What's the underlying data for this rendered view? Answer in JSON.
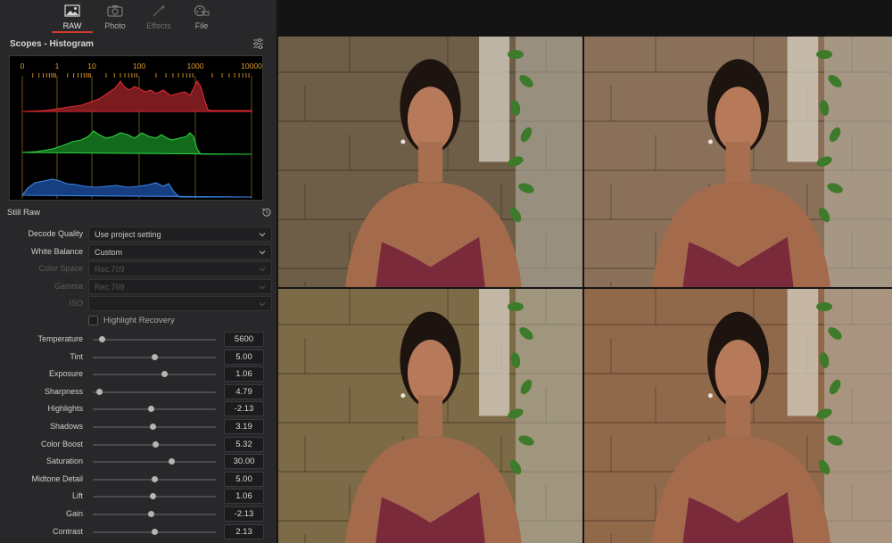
{
  "tabs": [
    {
      "label": "RAW",
      "icon": "image-icon",
      "state": "active"
    },
    {
      "label": "Photo",
      "icon": "camera-icon",
      "state": "normal"
    },
    {
      "label": "Effects",
      "icon": "magic-wand-icon",
      "state": "disabled"
    },
    {
      "label": "File",
      "icon": "film-reel-icon",
      "state": "normal"
    }
  ],
  "scopes": {
    "title": "Scopes - Histogram",
    "settings_icon": "sliders-icon",
    "scale_labels": [
      "0",
      "1",
      "10",
      "100",
      "1000",
      "10000"
    ],
    "channel_colors": {
      "red": "#d8242c",
      "green": "#22c03a",
      "blue": "#2a6fd6"
    }
  },
  "still_raw": {
    "title": "Still Raw",
    "reset_icon": "reset-icon",
    "dropdowns": [
      {
        "label": "Decode Quality",
        "value": "Use project setting",
        "enabled": true
      },
      {
        "label": "White Balance",
        "value": "Custom",
        "enabled": true
      },
      {
        "label": "Color Space",
        "value": "Rec.709",
        "enabled": false
      },
      {
        "label": "Gamma",
        "value": "Rec.709",
        "enabled": false
      },
      {
        "label": "ISO",
        "value": "",
        "enabled": false
      }
    ],
    "highlight_recovery": {
      "label": "Highlight Recovery",
      "checked": false
    },
    "sliders": [
      {
        "label": "Temperature",
        "value": "5600",
        "level": 0.05
      },
      {
        "label": "Tint",
        "value": "5.00",
        "level": 0.5
      },
      {
        "label": "Exposure",
        "value": "1.06",
        "level": 0.59
      },
      {
        "label": "Sharpness",
        "value": "4.79",
        "level": 0.03
      },
      {
        "label": "Highlights",
        "value": "-2.13",
        "level": 0.47
      },
      {
        "label": "Shadows",
        "value": "3.19",
        "level": 0.49
      },
      {
        "label": "Color Boost",
        "value": "5.32",
        "level": 0.51
      },
      {
        "label": "Saturation",
        "value": "30.00",
        "level": 0.65
      },
      {
        "label": "Midtone Detail",
        "value": "5.00",
        "level": 0.5
      },
      {
        "label": "Lift",
        "value": "1.06",
        "level": 0.49
      },
      {
        "label": "Gain",
        "value": "-2.13",
        "level": 0.47
      },
      {
        "label": "Contrast",
        "value": "2.13",
        "level": 0.5
      }
    ]
  },
  "viewer": {
    "frames": [
      {
        "tint": "#6e5e48"
      },
      {
        "tint": "#8a7058"
      },
      {
        "tint": "#7d6a46"
      },
      {
        "tint": "#90684a"
      }
    ]
  }
}
